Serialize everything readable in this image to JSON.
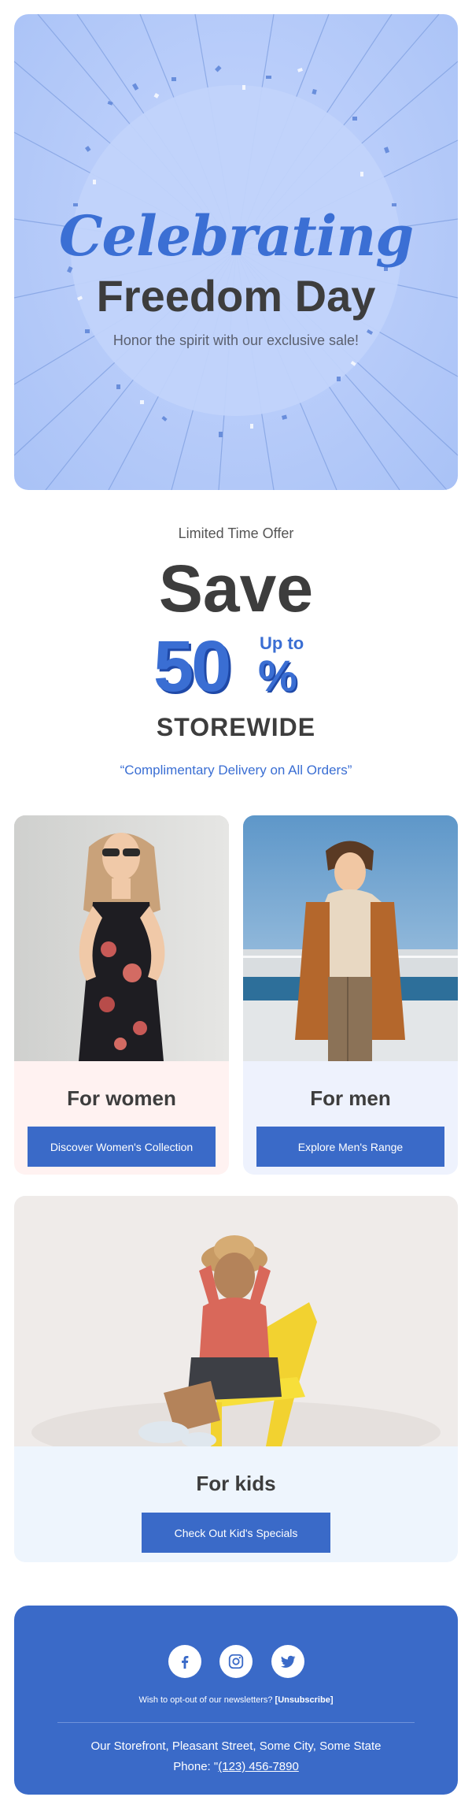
{
  "hero": {
    "script_title": "Celebrating",
    "title": "Freedom Day",
    "subtitle": "Honor the spirit with our exclusive sale!"
  },
  "offer": {
    "kicker": "Limited Time Offer",
    "save": "Save",
    "up_to": "Up to",
    "number": "50",
    "percent_sign": "%",
    "storewide": "STOREWIDE",
    "delivery": "“Complimentary Delivery on All Orders”"
  },
  "categories": [
    {
      "label": "For women",
      "button": "Discover Women's Collection"
    },
    {
      "label": "For men",
      "button": "Explore Men's Range"
    },
    {
      "label": "For kids",
      "button": "Check Out Kid's Specials"
    }
  ],
  "footer": {
    "social_icons": [
      "facebook-icon",
      "instagram-icon",
      "twitter-icon"
    ],
    "optout_text": "Wish to opt-out of our newsletters?",
    "unsubscribe": "[Unsubscribe]",
    "address": "Our Storefront, Pleasant Street, Some City, Some State",
    "phone_prefix": "Phone: \"",
    "phone": "(123) 456-7890"
  },
  "colors": {
    "accent": "#3a6ac8",
    "hero_bg": "#b9cdfa",
    "women_card": "#fff2f1",
    "men_card": "#eef2fd",
    "kids_card": "#eef5fd",
    "text_dark": "#3d3d3d"
  }
}
